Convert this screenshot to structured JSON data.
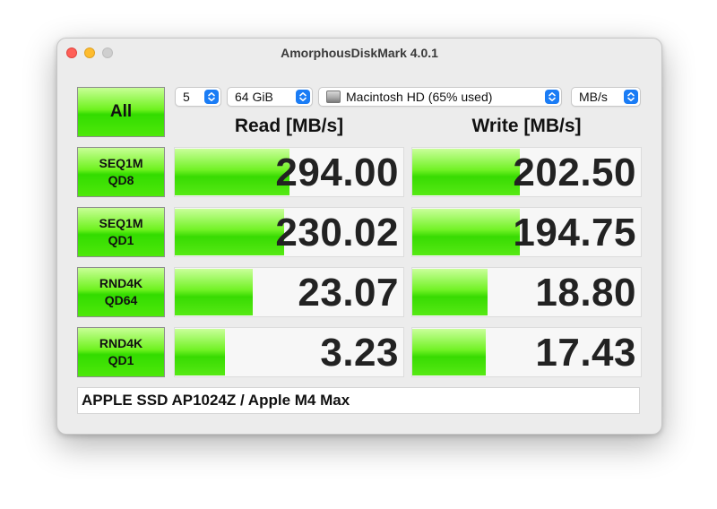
{
  "window": {
    "title": "AmorphousDiskMark 4.0.1"
  },
  "controls": {
    "all_label": "All",
    "count": "5",
    "size": "64 GiB",
    "disk": "Macintosh HD (65% used)",
    "unit": "MB/s"
  },
  "headers": {
    "read": "Read [MB/s]",
    "write": "Write [MB/s]"
  },
  "tests": [
    {
      "label_line1": "SEQ1M",
      "label_line2": "QD8",
      "read": "294.00",
      "write": "202.50",
      "read_fill": 0.5,
      "write_fill": 0.47
    },
    {
      "label_line1": "SEQ1M",
      "label_line2": "QD1",
      "read": "230.02",
      "write": "194.75",
      "read_fill": 0.48,
      "write_fill": 0.47
    },
    {
      "label_line1": "RND4K",
      "label_line2": "QD64",
      "read": "23.07",
      "write": "18.80",
      "read_fill": 0.34,
      "write_fill": 0.33
    },
    {
      "label_line1": "RND4K",
      "label_line2": "QD1",
      "read": "3.23",
      "write": "17.43",
      "read_fill": 0.22,
      "write_fill": 0.32
    }
  ],
  "footer": {
    "device": "APPLE SSD AP1024Z / Apple M4 Max"
  },
  "colors": {
    "bar_green": "#38db02",
    "accent_blue": "#1a7cf5"
  },
  "icons": {
    "popup": "chevron-updown-icon",
    "disk": "internal-disk-icon"
  }
}
